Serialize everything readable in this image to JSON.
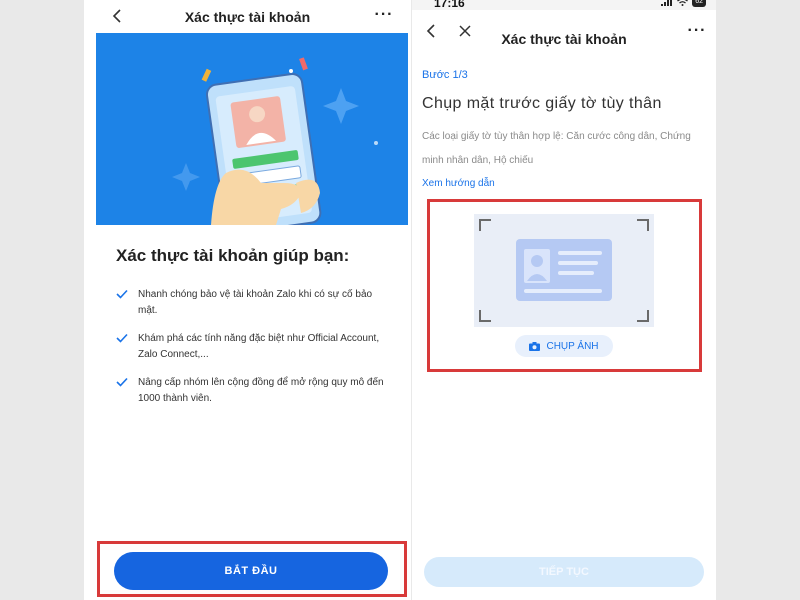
{
  "left": {
    "header_title": "Xác thực tài khoản",
    "heading": "Xác thực tài khoản giúp bạn:",
    "benefits": [
      {
        "text": "Nhanh chóng bảo vệ tài khoản Zalo khi có sự cố bảo mật."
      },
      {
        "text": "Khám phá các tính năng đặc biệt như Official Account, Zalo Connect,..."
      },
      {
        "text": "Nâng cấp nhóm lên cộng đồng để mở rộng quy mô đến 1000 thành viên."
      }
    ],
    "start_label": "BẮT ĐẦU"
  },
  "right": {
    "status_time": "17:16",
    "battery_level": "62",
    "header_title": "Xác thực tài khoản",
    "step": "Bước 1/3",
    "heading": "Chụp mặt trước giấy tờ tùy thân",
    "description": "Các loại giấy tờ tùy thân hợp lệ: Căn cước công dân, Chứng minh nhân dân, Hộ chiếu",
    "guide_link": "Xem hướng dẫn",
    "capture_label": "CHỤP ẢNH",
    "continue_label": "TIẾP TỤC"
  },
  "colors": {
    "primary_blue": "#1665e0",
    "banner_blue": "#1d83e7",
    "highlight_red": "#d83a3a",
    "disabled_button": "#d6eafb"
  },
  "icons": [
    "back-arrow-icon",
    "more-icon",
    "close-icon",
    "check-icon",
    "camera-icon",
    "signal-icon",
    "wifi-icon",
    "battery-icon"
  ]
}
